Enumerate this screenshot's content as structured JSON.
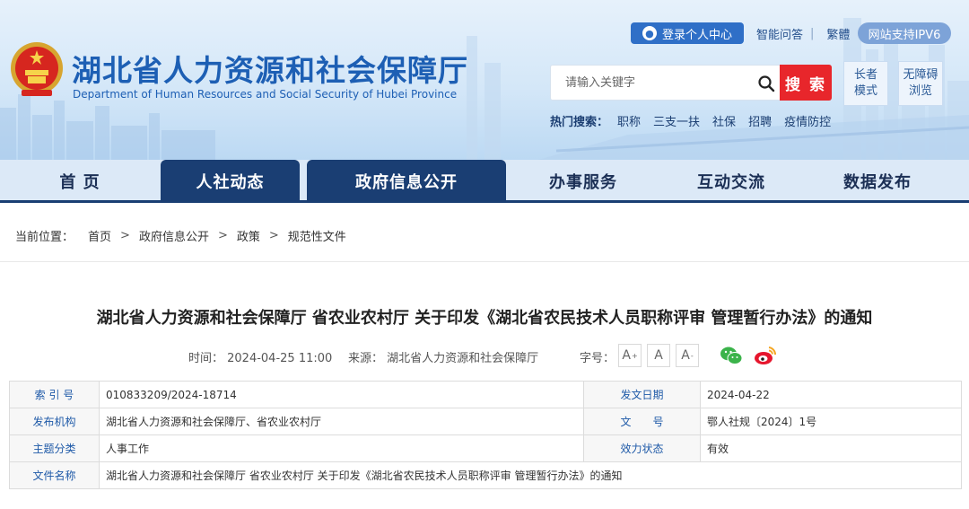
{
  "header": {
    "title": "湖北省人力资源和社会保障厅",
    "subtitle": "Department of Human Resources and Social Security of Hubei Province",
    "login": "登录个人中心",
    "links": [
      "智能问答",
      "繁體"
    ],
    "ipv6": "网站支持IPV6",
    "search_placeholder": "请输入关键字",
    "search_button": "搜 索",
    "elder_mode": "长者\n模式",
    "accessible": "无障碍\n浏览",
    "hot_label": "热门搜索：",
    "hot_items": [
      "职称",
      "三支一扶",
      "社保",
      "招聘",
      "疫情防控"
    ]
  },
  "nav": {
    "items": [
      "首 页",
      "人社动态",
      "政府信息公开",
      "办事服务",
      "互动交流",
      "数据发布"
    ]
  },
  "breadcrumb": {
    "label": "当前位置：",
    "items": [
      "首页",
      "政府信息公开",
      "政策",
      "规范性文件"
    ],
    "sep": ">"
  },
  "article": {
    "title": "湖北省人力资源和社会保障厅 省农业农村厅 关于印发《湖北省农民技术人员职称评审 管理暂行办法》的通知",
    "time": "时间：  2024-04-25 11:00",
    "source": "来源：  湖北省人力资源和社会保障厅",
    "font_label": "字号：",
    "font_buttons": [
      "A",
      "A",
      "A"
    ]
  },
  "info": {
    "rows": [
      {
        "k1": "索 引 号",
        "v1": "010833209/2024-18714",
        "k2": "发文日期",
        "v2": "2024-04-22"
      },
      {
        "k1": "发布机构",
        "v1": "湖北省人力资源和社会保障厅、省农业农村厅",
        "k2": "文　　号",
        "v2": "鄂人社规〔2024〕1号"
      },
      {
        "k1": "主题分类",
        "v1": "人事工作",
        "k2": "效力状态",
        "v2": "有效"
      }
    ],
    "name_key": "文件名称",
    "name_value": "湖北省人力资源和社会保障厅 省农业农村厅 关于印发《湖北省农民技术人员职称评审 管理暂行办法》的通知"
  },
  "colors": {
    "primary": "#1a3e73",
    "accent_red": "#e8262b",
    "title_blue": "#1d5fb4"
  }
}
